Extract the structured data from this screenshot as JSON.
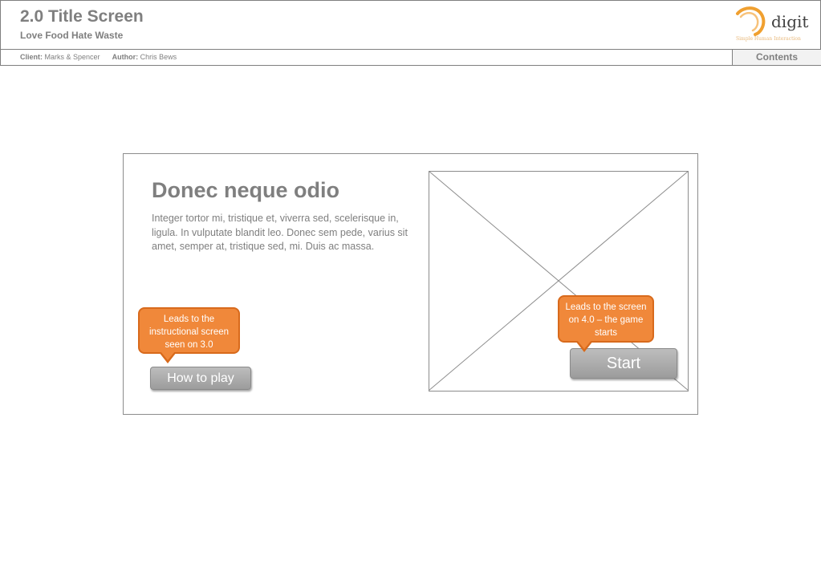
{
  "header": {
    "title": "2.0 Title Screen",
    "subtitle": "Love Food Hate Waste",
    "logo": {
      "word": "digit",
      "tagline": "Simple Human Interaction",
      "icon": "swirl-logo-icon",
      "accent": "#f0a030"
    }
  },
  "info_bar": {
    "client_label": "Client:",
    "client_value": "Marks & Spencer",
    "author_label": "Author:",
    "author_value": "Chris Bews",
    "contents_label": "Contents"
  },
  "screen": {
    "heading": "Donec neque odio",
    "body": "Integer tortor mi, tristique et, viverra sed, scelerisque in, ligula. In vulputate blandit leo. Donec sem pede, varius sit amet, semper at, tristique sed, mi. Duis ac massa.",
    "image_icon": "image-placeholder-icon",
    "how_to_play_label": "How to play",
    "start_label": "Start"
  },
  "annotations": {
    "how_to_play_note": "Leads to the instructional screen seen on 3.0",
    "start_note": "Leads to the screen on 4.0 – the game starts",
    "note_color": "#f0883a"
  }
}
